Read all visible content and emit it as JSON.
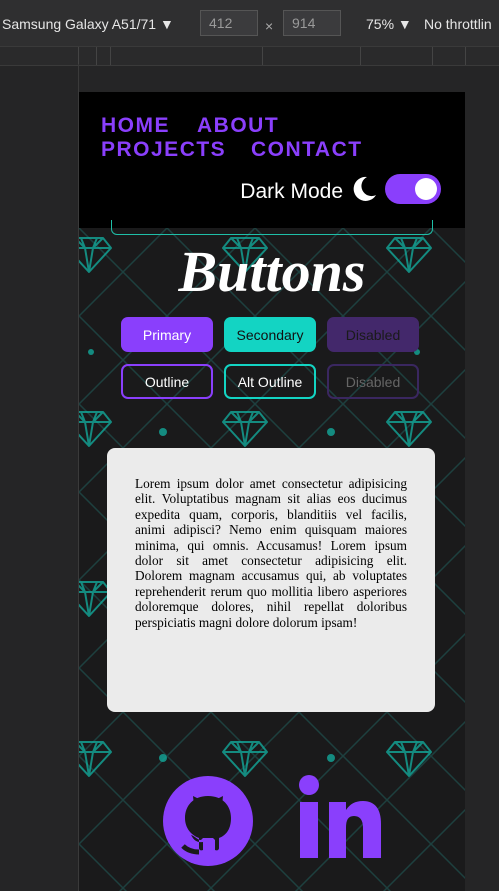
{
  "devtools": {
    "device": "Samsung Galaxy A51/71",
    "width": "412",
    "height": "914",
    "dim_separator": "×",
    "zoom": "75%",
    "throttling": "No throttlin"
  },
  "nav": {
    "home": "HOME",
    "about": "ABOUT",
    "projects": "PROJECTS",
    "contact": "CONTACT",
    "dark_mode_label": "Dark Mode",
    "dark_mode_on": true
  },
  "page": {
    "title": "Buttons"
  },
  "buttons": {
    "primary": "Primary",
    "secondary": "Secondary",
    "disabled": "Disabled",
    "outline": "Outline",
    "alt_outline": "Alt Outline",
    "disabled_outline": "Disabled"
  },
  "card": {
    "text": "Lorem ipsum dolor amet consectetur adipisicing elit. Voluptatibus magnam sit alias eos ducimus expedita quam, corporis, blanditiis vel facilis, animi adipisci? Nemo enim quisquam maiores minima, qui omnis. Accusamus! Lorem ipsum dolor sit amet consectetur adipisicing elit. Dolorem magnam accusamus qui, ab voluptates reprehenderit rerum quo mollitia libero asperiores doloremque dolores, nihil repellat doloribus perspiciatis magni dolore dolorum ipsam!"
  },
  "social": [
    "github-icon",
    "linkedin-icon"
  ],
  "colors": {
    "accent": "#8a3ffc",
    "secondary": "#13d4c3",
    "card": "#ebebeb",
    "background": "#1a1a1b"
  }
}
